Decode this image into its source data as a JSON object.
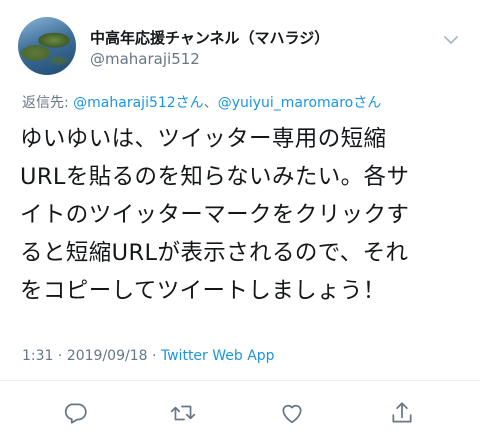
{
  "user": {
    "display_name": "中高年応援チャンネル（マハラジ）",
    "handle": "@maharaji512"
  },
  "reply": {
    "prefix": "返信先: ",
    "to1": "@maharaji512さん",
    "separator": "、",
    "to2": "@yuiyui_maromaroさん"
  },
  "tweet": {
    "lines": [
      "ゆいゆいは、ツイッター専用の短縮",
      "URLを貼るのを知らないみたい。各サ",
      "イトのツイッターマークをクリックす",
      "ると短縮URLが表示されるので、それ",
      "をコピーしてツイートしましょう！"
    ]
  },
  "meta": {
    "time": "1:31",
    "dot": " · ",
    "date": "2019/09/18",
    "dot2": " · ",
    "app": "Twitter Web App"
  },
  "icons": {
    "avatar": "avatar-image",
    "more": "chevron-down-icon",
    "reply": "reply-icon",
    "retweet": "retweet-icon",
    "like": "heart-icon",
    "share": "share-icon"
  },
  "colors": {
    "link": "#1b95e0",
    "muted": "#657786",
    "text": "#14171a"
  }
}
